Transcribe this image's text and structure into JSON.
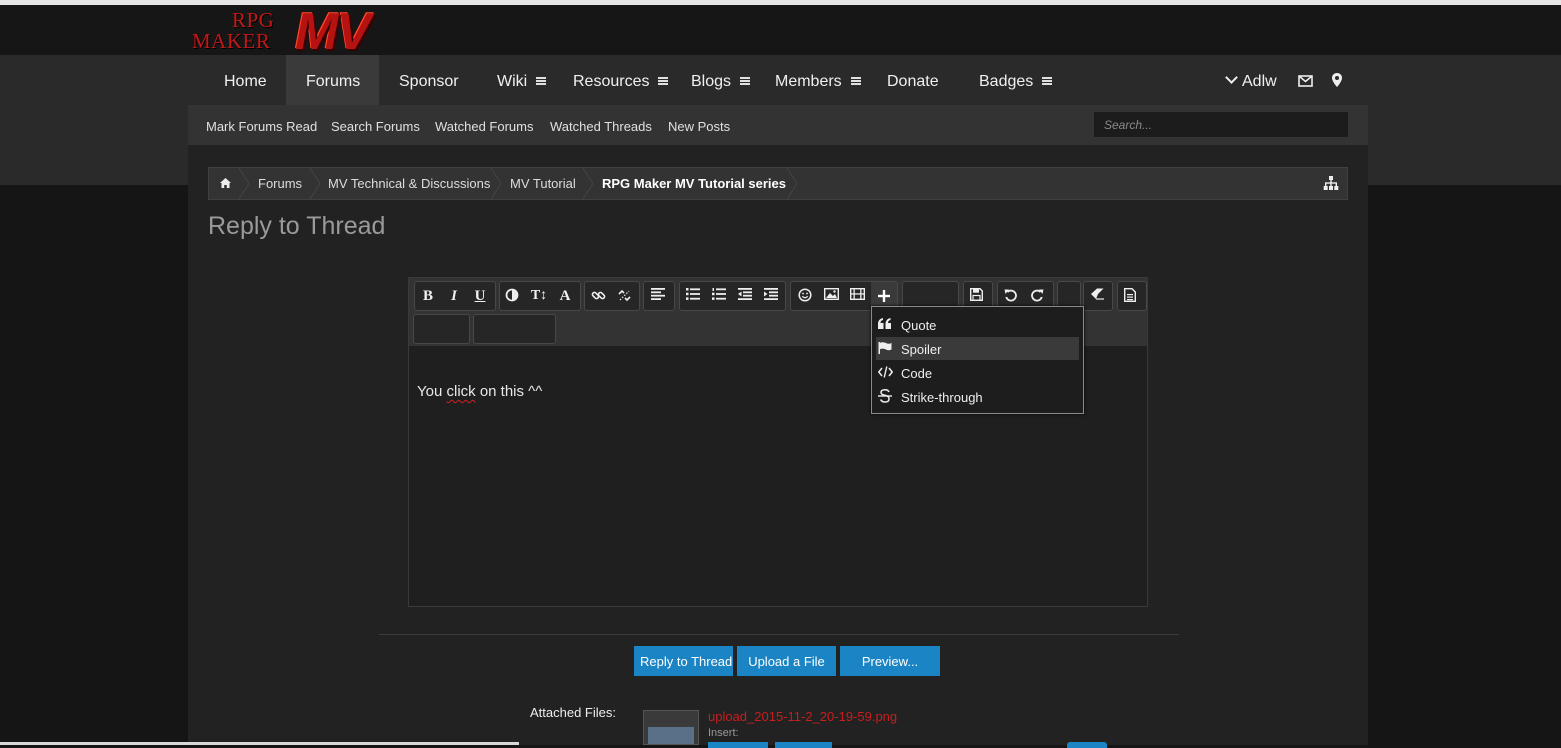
{
  "logo": {
    "line1": "RPG",
    "line2": "MAKER",
    "mark": "MV"
  },
  "nav": {
    "items": [
      {
        "label": "Home",
        "menu": false,
        "active": false
      },
      {
        "label": "Forums",
        "menu": false,
        "active": true
      },
      {
        "label": "Sponsor",
        "menu": false,
        "active": false
      },
      {
        "label": "Wiki",
        "menu": true,
        "active": false
      },
      {
        "label": "Resources",
        "menu": true,
        "active": false
      },
      {
        "label": "Blogs",
        "menu": true,
        "active": false
      },
      {
        "label": "Members",
        "menu": true,
        "active": false
      },
      {
        "label": "Donate",
        "menu": false,
        "active": false
      },
      {
        "label": "Badges",
        "menu": true,
        "active": false
      }
    ],
    "user": "Adlw",
    "icons": [
      "chevron-down-icon",
      "envelope-icon",
      "map-marker-icon"
    ]
  },
  "subnav": {
    "links": [
      "Mark Forums Read",
      "Search Forums",
      "Watched Forums",
      "Watched Threads",
      "New Posts"
    ],
    "search_placeholder": "Search..."
  },
  "breadcrumb": {
    "items": [
      "Forums",
      "MV Technical & Discussions",
      "MV Tutorial",
      "RPG Maker MV Tutorial series"
    ]
  },
  "page_title": "Reply to Thread",
  "editor": {
    "toolbar_row1": [
      "B",
      "I",
      "U",
      "T↕",
      "A"
    ],
    "content": "You click on this ^^",
    "squiggle_word": "click"
  },
  "insert_menu": {
    "items": [
      {
        "label": "Quote",
        "icon": "quote-icon",
        "hovered": false
      },
      {
        "label": "Spoiler",
        "icon": "flag-icon",
        "hovered": true
      },
      {
        "label": "Code",
        "icon": "code-icon",
        "hovered": false
      },
      {
        "label": "Strike-through",
        "icon": "strikethrough-icon",
        "hovered": false
      }
    ]
  },
  "buttons": {
    "reply": "Reply to Thread",
    "upload": "Upload a File",
    "preview": "Preview..."
  },
  "attachments": {
    "label": "Attached Files:",
    "file_name": "upload_2015-11-2_20-19-59.png",
    "insert_label": "Insert:"
  },
  "colors": {
    "accent": "#1b84c4",
    "file_link": "#c81e1e",
    "logo_red": "#b71212"
  }
}
